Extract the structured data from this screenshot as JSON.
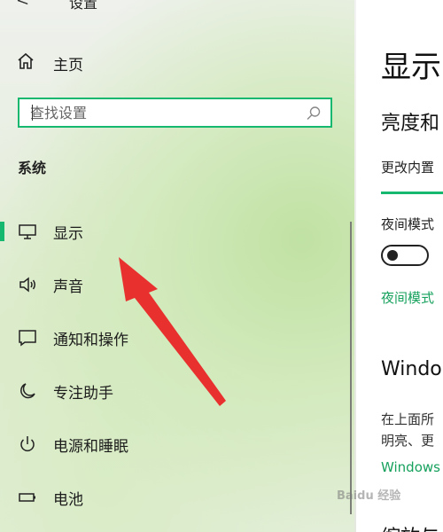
{
  "window": {
    "back_glyph": "<",
    "title": "设置"
  },
  "nav": {
    "home_label": "主页",
    "search_placeholder": "查找设置",
    "section_title": "系统",
    "items": [
      {
        "label": "显示",
        "icon": "monitor-icon",
        "active": true
      },
      {
        "label": "声音",
        "icon": "speaker-icon"
      },
      {
        "label": "通知和操作",
        "icon": "notification-icon"
      },
      {
        "label": "专注助手",
        "icon": "moon-icon"
      },
      {
        "label": "电源和睡眠",
        "icon": "power-icon"
      },
      {
        "label": "电池",
        "icon": "battery-icon"
      }
    ]
  },
  "content": {
    "title": "显示",
    "brightness_heading": "亮度和",
    "change_builtin": "更改内置",
    "night_mode": "夜间模式",
    "night_mode_link": "夜间模式",
    "windows_heading": "Windo",
    "desc_line1": "在上面所",
    "desc_line2": "明亮、更",
    "windows_link": "Windows",
    "scale_heading": "缩放与"
  },
  "watermark": "Baidu 经验",
  "colors": {
    "accent": "#16b86f",
    "link": "#16a15d",
    "arrow": "#e8312f"
  }
}
